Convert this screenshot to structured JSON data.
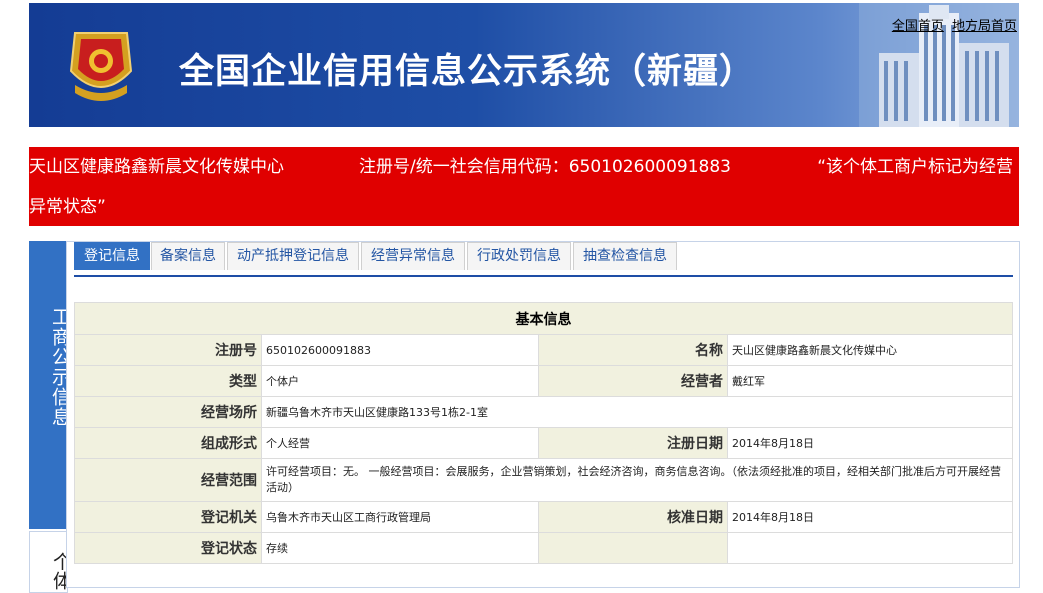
{
  "header": {
    "title": "全国企业信用信息公示系统（新疆）",
    "links": [
      "全国首页",
      "地方局首页"
    ]
  },
  "notice": {
    "name": "天山区健康路鑫新晨文化传媒中心",
    "reg": "注册号/统一社会信用代码：650102600091883",
    "status_part1": "“该个体工商户标记为经营",
    "status_part2": "异常状态”"
  },
  "sidebar": {
    "tab1": "工商公示信息",
    "tab2": "个体"
  },
  "tabs": [
    "登记信息",
    "备案信息",
    "动产抵押登记信息",
    "经营异常信息",
    "行政处罚信息",
    "抽查检查信息"
  ],
  "table": {
    "title": "基本信息",
    "reg_no_label": "注册号",
    "reg_no": "650102600091883",
    "name_label": "名称",
    "name": "天山区健康路鑫新晨文化传媒中心",
    "type_label": "类型",
    "type": "个体户",
    "operator_label": "经营者",
    "operator": "戴红军",
    "place_label": "经营场所",
    "place": "新疆乌鲁木齐市天山区健康路133号1栋2-1室",
    "form_label": "组成形式",
    "form": "个人经营",
    "reg_date_label": "注册日期",
    "reg_date": "2014年8月18日",
    "scope_label": "经营范围",
    "scope": "许可经营项目：无。 一般经营项目：会展服务，企业营销策划，社会经济咨询，商务信息咨询。（依法须经批准的项目，经相关部门批准后方可开展经营活动）",
    "authority_label": "登记机关",
    "authority": "乌鲁木齐市天山区工商行政管理局",
    "approve_date_label": "核准日期",
    "approve_date": "2014年8月18日",
    "status_label": "登记状态",
    "status": "存续"
  }
}
